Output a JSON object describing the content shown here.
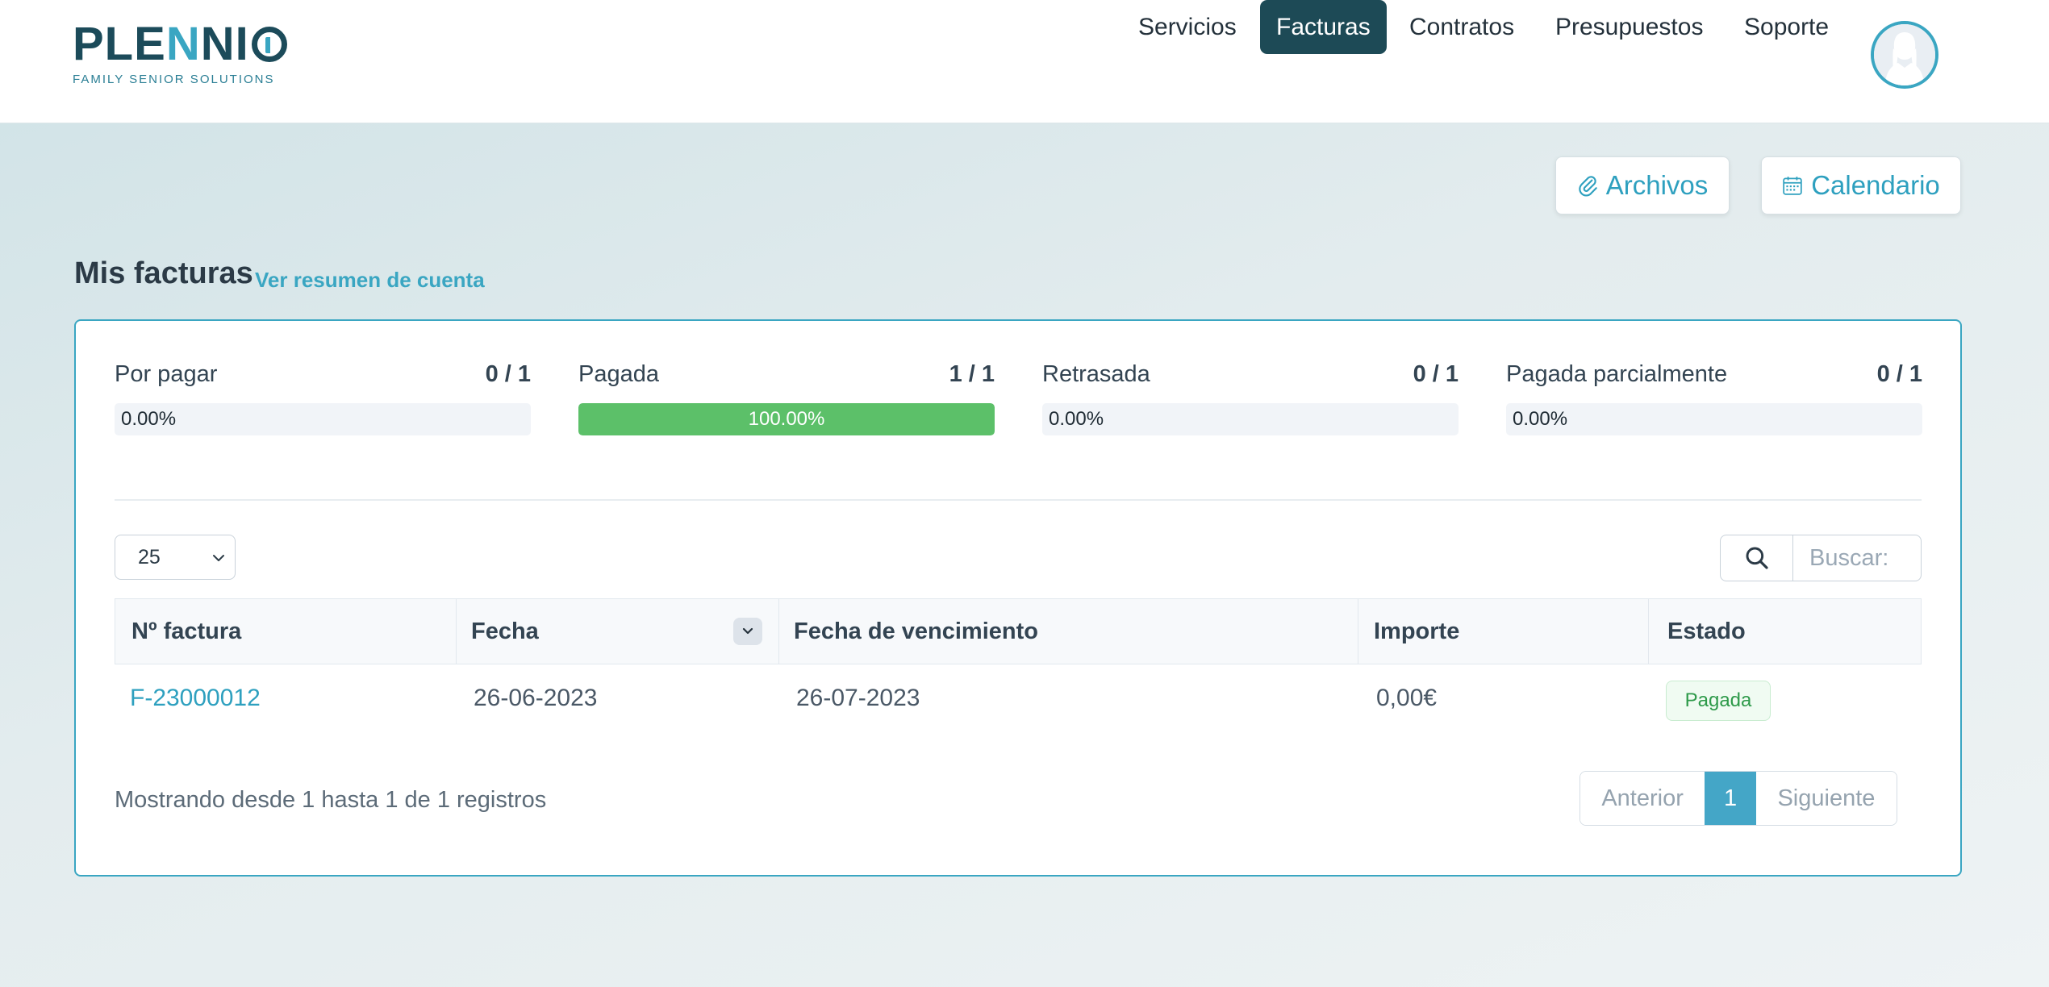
{
  "brand": {
    "name_part1": "PLE",
    "name_accent": "N",
    "name_part2": "NI",
    "tagline": "FAMILY SENIOR SOLUTIONS"
  },
  "nav": {
    "items": [
      {
        "label": "Servicios",
        "active": false
      },
      {
        "label": "Facturas",
        "active": true
      },
      {
        "label": "Contratos",
        "active": false
      },
      {
        "label": "Presupuestos",
        "active": false
      },
      {
        "label": "Soporte",
        "active": false
      }
    ]
  },
  "actions": {
    "files_label": "Archivos",
    "calendar_label": "Calendario"
  },
  "page": {
    "title": "Mis facturas",
    "summary_link": "Ver resumen de cuenta"
  },
  "stats": [
    {
      "label": "Por pagar",
      "count": "0 / 1",
      "percent_text": "0.00%",
      "fill": 0
    },
    {
      "label": "Pagada",
      "count": "1 / 1",
      "percent_text": "100.00%",
      "fill": 1
    },
    {
      "label": "Retrasada",
      "count": "0 / 1",
      "percent_text": "0.00%",
      "fill": 0
    },
    {
      "label": "Pagada parcialmente",
      "count": "0 / 1",
      "percent_text": "0.00%",
      "fill": 0
    }
  ],
  "table_controls": {
    "page_length": "25",
    "search_placeholder": "Buscar:"
  },
  "table": {
    "columns": [
      "Nº factura",
      "Fecha",
      "Fecha de vencimiento",
      "Importe",
      "Estado"
    ],
    "rows": [
      {
        "invoice": "F-23000012",
        "date": "26-06-2023",
        "due_date": "26-07-2023",
        "amount": "0,00€",
        "status": "Pagada"
      }
    ]
  },
  "footer": {
    "info": "Mostrando desde 1 hasta 1 de 1 registros",
    "prev": "Anterior",
    "current_page": "1",
    "next": "Siguiente"
  },
  "colors": {
    "brand_dark": "#1c4b5a",
    "accent": "#3aa6c2",
    "success": "#5cc069",
    "nav_active": "#1d4a56"
  },
  "icons": {
    "files": "paperclip-icon",
    "calendar": "calendar-icon",
    "search": "search-icon",
    "sort": "chevron-down-icon",
    "select": "chevron-down-icon"
  }
}
